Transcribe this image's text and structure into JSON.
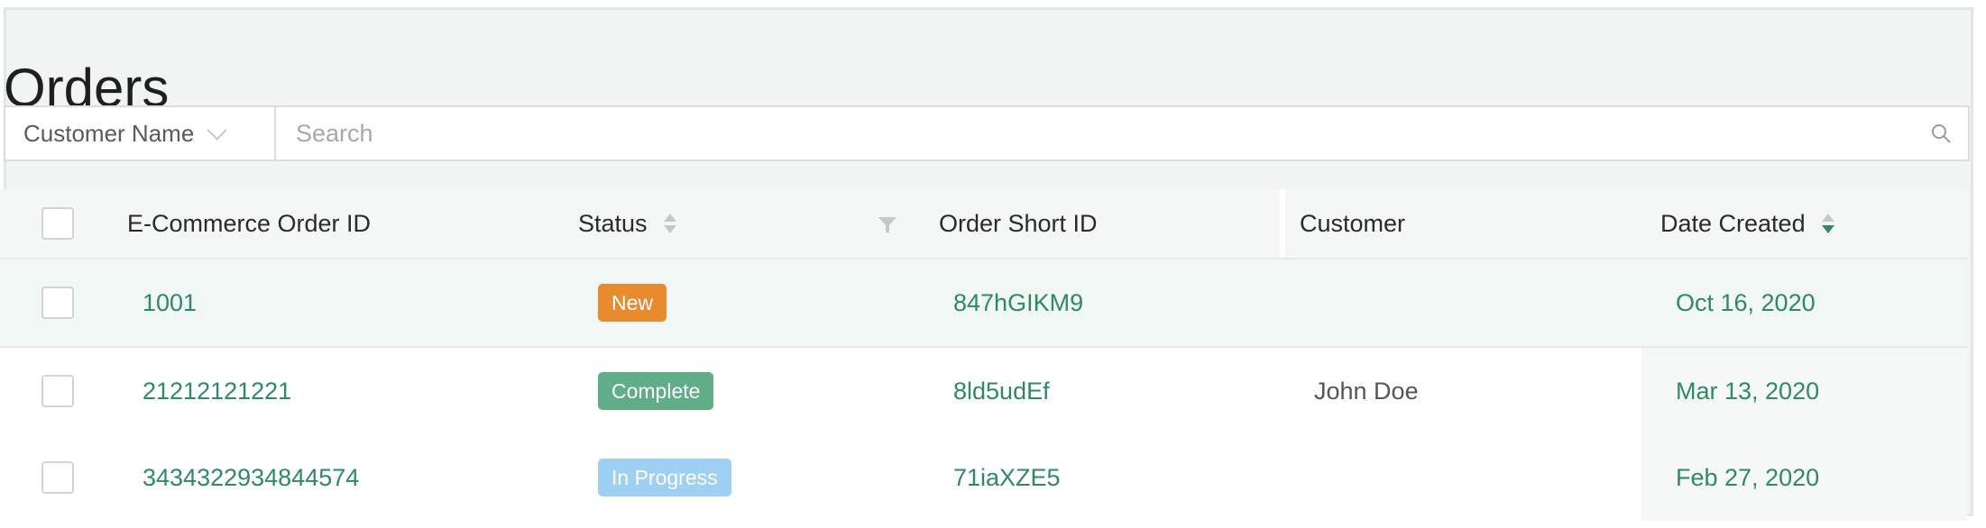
{
  "page": {
    "title": "Orders"
  },
  "search": {
    "field_label": "Customer Name",
    "placeholder": "Search",
    "value": ""
  },
  "table": {
    "columns": {
      "order_id": "E-Commerce Order ID",
      "status": "Status",
      "short_id": "Order Short ID",
      "customer": "Customer",
      "date": "Date Created"
    },
    "rows": [
      {
        "order_id": "1001",
        "status": "New",
        "status_color": "#e88a2e",
        "short_id": "847hGIKM9",
        "customer": "",
        "date": "Oct 16, 2020"
      },
      {
        "order_id": "21212121221",
        "status": "Complete",
        "status_color": "#5fae88",
        "short_id": "8ld5udEf",
        "customer": "John Doe",
        "date": "Mar 13, 2020"
      },
      {
        "order_id": "3434322934844574",
        "status": "In Progress",
        "status_color": "#9ed0f4",
        "short_id": "71iaXZE5",
        "customer": "",
        "date": "Feb 27, 2020"
      }
    ]
  },
  "icons": {
    "search": "search-icon",
    "dropdown": "chevron-down-icon",
    "sort": "sort-icon",
    "filter": "filter-icon"
  },
  "colors": {
    "link": "#2e8a63",
    "active_sort": "#2f8a64",
    "header_bg": "#f2f3f3"
  }
}
